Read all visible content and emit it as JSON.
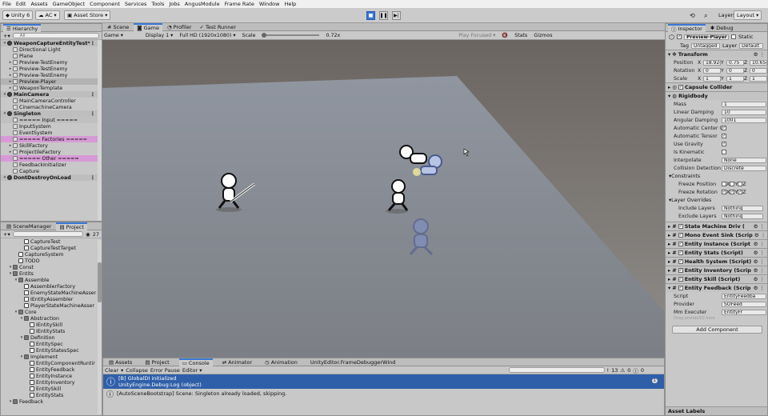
{
  "menu": [
    "File",
    "Edit",
    "Assets",
    "GameObject",
    "Component",
    "Services",
    "Tools",
    "Jobs",
    "AngusModule",
    "Frame Rate",
    "Window",
    "Help"
  ],
  "toolbar": {
    "account": "Unity 6",
    "ac": "AC",
    "asset_store": "Asset Store",
    "layers": "Layers",
    "layout": "Layout"
  },
  "hierarchy": {
    "tab": "Hierarchy",
    "search_placeholder": "All",
    "items": [
      {
        "t": "WeaponCaptureEntityTest*",
        "d": 0,
        "k": "scene"
      },
      {
        "t": "Directional Light",
        "d": 1,
        "k": "go"
      },
      {
        "t": "Plane",
        "d": 1,
        "k": "go"
      },
      {
        "t": "Preview-TestEnemy",
        "d": 1,
        "k": "go",
        "e": 1
      },
      {
        "t": "Preview-TestEnemy",
        "d": 1,
        "k": "go",
        "e": 1
      },
      {
        "t": "Preview-TestEnemy",
        "d": 1,
        "k": "go",
        "e": 1
      },
      {
        "t": "Preview-Player",
        "d": 1,
        "k": "go",
        "e": 1,
        "s": "hl"
      },
      {
        "t": "WeaponTemplate",
        "d": 1,
        "k": "go",
        "e": 1
      },
      {
        "t": "MainCamera",
        "d": 0,
        "k": "scene"
      },
      {
        "t": "MainCameraController",
        "d": 1,
        "k": "go"
      },
      {
        "t": "CinemachineCamera",
        "d": 1,
        "k": "go"
      },
      {
        "t": "Singleton",
        "d": 0,
        "k": "scene"
      },
      {
        "t": "===== Input =====",
        "d": 1,
        "k": "go",
        "s": "gray"
      },
      {
        "t": "InputSystem",
        "d": 1,
        "k": "go"
      },
      {
        "t": "EventSystem",
        "d": 1,
        "k": "go"
      },
      {
        "t": "===== Factories =====",
        "d": 1,
        "k": "go",
        "s": "pink"
      },
      {
        "t": "SkillFactory",
        "d": 1,
        "k": "go",
        "e": 1
      },
      {
        "t": "ProjectileFactory",
        "d": 1,
        "k": "go",
        "e": 1
      },
      {
        "t": "===== Other =====",
        "d": 1,
        "k": "go",
        "s": "pink"
      },
      {
        "t": "FeedbackInitializer",
        "d": 1,
        "k": "go"
      },
      {
        "t": "Capture",
        "d": 1,
        "k": "go"
      },
      {
        "t": "DontDestroyOnLoad",
        "d": 0,
        "k": "scene"
      }
    ]
  },
  "project": {
    "tabs": [
      "SceneManager",
      "Project"
    ],
    "count": "27",
    "items": [
      {
        "t": "CaptureTest",
        "d": 3,
        "k": "script"
      },
      {
        "t": "CaptureTestTarget",
        "d": 3,
        "k": "script"
      },
      {
        "t": "CaptureSystem",
        "d": 2,
        "k": "script"
      },
      {
        "t": "TODO",
        "d": 2,
        "k": "script"
      },
      {
        "t": "Const",
        "d": 1,
        "k": "folder",
        "e": 1
      },
      {
        "t": "Entits",
        "d": 1,
        "k": "folder",
        "e": 1
      },
      {
        "t": "Assemble",
        "d": 2,
        "k": "folder",
        "e": 1
      },
      {
        "t": "AssemblerFactory",
        "d": 3,
        "k": "script"
      },
      {
        "t": "EnemyStateMachineAsser",
        "d": 3,
        "k": "script"
      },
      {
        "t": "IEntityAssembler",
        "d": 3,
        "k": "script"
      },
      {
        "t": "PlayerStateMachineAsser",
        "d": 3,
        "k": "script"
      },
      {
        "t": "Core",
        "d": 2,
        "k": "folder",
        "e": 1
      },
      {
        "t": "Abstraction",
        "d": 3,
        "k": "folder",
        "e": 1
      },
      {
        "t": "IEntitySkill",
        "d": 4,
        "k": "script"
      },
      {
        "t": "IEntityStats",
        "d": 4,
        "k": "script"
      },
      {
        "t": "Definition",
        "d": 3,
        "k": "folder",
        "e": 1
      },
      {
        "t": "EntitySpec",
        "d": 4,
        "k": "script"
      },
      {
        "t": "EntityStatesSpec",
        "d": 4,
        "k": "script"
      },
      {
        "t": "Implement",
        "d": 3,
        "k": "folder",
        "e": 1
      },
      {
        "t": "EntityComponentRuntir",
        "d": 4,
        "k": "script"
      },
      {
        "t": "EntityFeedback",
        "d": 4,
        "k": "script"
      },
      {
        "t": "EntityInstance",
        "d": 4,
        "k": "script"
      },
      {
        "t": "EntityInventory",
        "d": 4,
        "k": "script"
      },
      {
        "t": "EntitySkill",
        "d": 4,
        "k": "script"
      },
      {
        "t": "EntityStats",
        "d": 4,
        "k": "script"
      },
      {
        "t": "Feedback",
        "d": 1,
        "k": "folder",
        "e": 1
      }
    ]
  },
  "game": {
    "tabs": [
      "Scene",
      "Game",
      "Profiler",
      "Test Runner"
    ],
    "view_mode": "Game",
    "display": "Display 1",
    "resolution": "Full HD (1920x1080)",
    "scale_label": "Scale",
    "scale_value": "0.72x",
    "play_focused": "Play Focused",
    "stats": "Stats",
    "gizmos": "Gizmos"
  },
  "inspector": {
    "tabs": [
      "Inspector",
      "Debug"
    ],
    "object_name": "Preview-Player",
    "static": "Static",
    "tag_label": "Tag",
    "tag": "Untagged",
    "layer_label": "Layer",
    "layer": "Default",
    "transform": {
      "title": "Transform",
      "position": {
        "label": "Position",
        "x": "18.924",
        "y": "0.75",
        "z": "10.654"
      },
      "rotation": {
        "label": "Rotation",
        "x": "0",
        "y": "0",
        "z": "0"
      },
      "scale": {
        "label": "Scale",
        "x": "1",
        "y": "1",
        "z": "1"
      }
    },
    "capsule": "Capsule Collider",
    "rigidbody": {
      "title": "Rigidbody",
      "rows": [
        {
          "label": "Mass",
          "value": "1"
        },
        {
          "label": "Linear Damping",
          "value": "10"
        },
        {
          "label": "Angular Damping",
          "value": "1001"
        },
        {
          "label": "Automatic Center Of",
          "check": true
        },
        {
          "label": "Automatic Tensor",
          "check": true
        },
        {
          "label": "Use Gravity",
          "check": true
        },
        {
          "label": "Is Kinematic",
          "check": false
        },
        {
          "label": "Interpolate",
          "value": "None"
        },
        {
          "label": "Collision Detection",
          "value": "Discrete"
        }
      ],
      "constraints": "Constraints",
      "freeze_pos": "Freeze Position",
      "freeze_rot": "Freeze Rotation",
      "layer_overrides": "Layer Overrides",
      "include": {
        "label": "Include Layers",
        "value": "Nothing"
      },
      "exclude": {
        "label": "Exclude Layers",
        "value": "Nothing"
      }
    },
    "components": [
      "State Machine Driv (",
      "Mono Event Sink (Scrip",
      "Entity Instance (Script",
      "Entity Stats (Script)",
      "Health System (Script)",
      "Entity Inventory (Scrip",
      "Entity Skill (Script)",
      "Entity Feedback (Scrip"
    ],
    "feedback_rows": [
      {
        "label": "Script",
        "value": "EntityFeedba"
      },
      {
        "label": "Provider",
        "value": "SOFeed"
      },
      {
        "label": "Mm Executer",
        "value": "EntityFr"
      }
    ],
    "footer_note": "Drag prefab/SO here",
    "add_component": "Add Component",
    "asset_labels": "Asset Labels"
  },
  "bottom": {
    "tabs": [
      "Assets",
      "Project",
      "Console",
      "Animator",
      "Animation",
      "UnityEditor.FrameDebuggerWind"
    ],
    "clear": "Clear",
    "collapse": "Collapse",
    "error_pause": "Error Pause",
    "editor": "Editor",
    "count_warn": "13",
    "count_err": "0",
    "count_info": "0",
    "log1_line1": "[B] GlobalDI initialized",
    "log1_line2": "UnityEngine.Debug:Log (object)",
    "log1_count": "1",
    "log2": "[AutoSceneBootstrap] Scene: Singleton already loaded, skipping."
  },
  "colors": {
    "accent": "#3b78d6",
    "pink_row": "#d79ad6",
    "selected_log": "#2f5fa8"
  }
}
